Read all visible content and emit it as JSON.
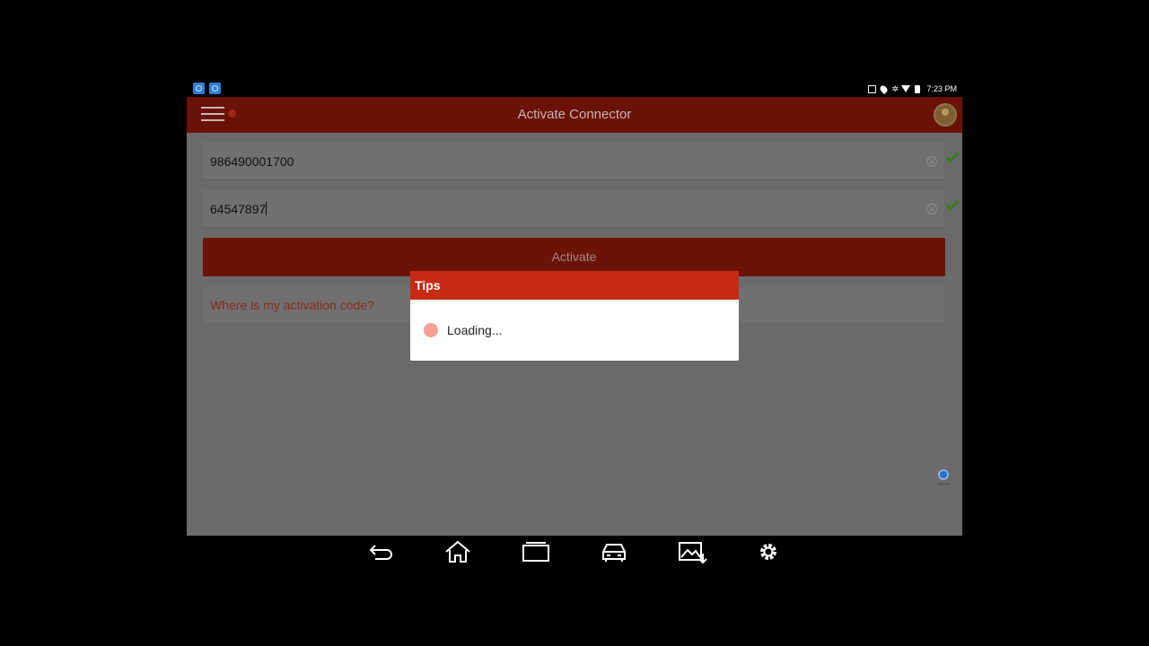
{
  "status_bar": {
    "time": "7:23 PM",
    "icons": [
      "notification-icon",
      "notification-icon",
      "cast-icon",
      "location-icon",
      "bluetooth-icon",
      "wifi-icon",
      "battery-icon"
    ]
  },
  "app_bar": {
    "title": "Activate Connector",
    "menu_icon": "hamburger-menu-icon",
    "avatar_icon": "user-avatar-icon"
  },
  "form": {
    "serial_number": "986490001700",
    "activation_code": "64547897",
    "activate_label": "Activate",
    "help_link": "Where is my activation code?"
  },
  "dialog": {
    "title": "Tips",
    "message": "Loading..."
  },
  "nav_bar": {
    "buttons": [
      "back-icon",
      "home-icon",
      "recent-apps-icon",
      "car-diagnostic-icon",
      "screenshot-icon",
      "settings-icon"
    ]
  },
  "colors": {
    "app_bar": "#6b1208",
    "dialog_header": "#c62a12",
    "check": "#3d7a23",
    "link": "#862a1c"
  }
}
